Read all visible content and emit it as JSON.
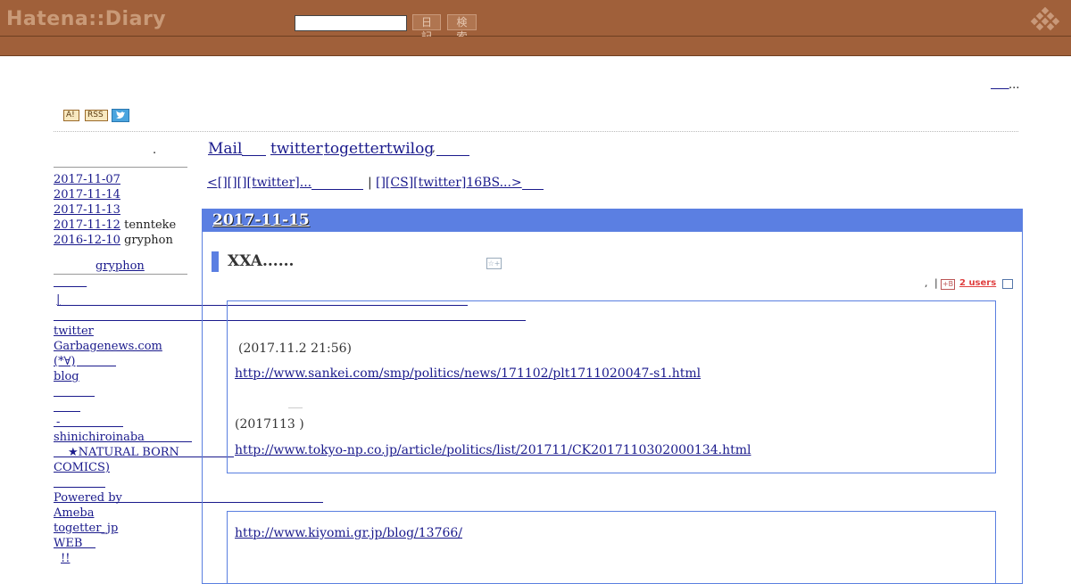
{
  "header": {
    "logo": "Hatena::Diary",
    "diary_button": "日記",
    "search_button": "検索"
  },
  "top_right": {
    "dots": "..."
  },
  "icons": {
    "antenna": "A!",
    "rss": "RSS",
    "twitter": "twitter-icon"
  },
  "sidebar": {
    "dot": ".",
    "recent": [
      {
        "date": "2017-11-07",
        "user": ""
      },
      {
        "date": "2017-11-14",
        "user": ""
      },
      {
        "date": "2017-11-13",
        "user": ""
      },
      {
        "date": "2017-11-12",
        "user": "tennteke"
      },
      {
        "date": "2016-12-10",
        "user": "gryphon"
      }
    ],
    "profile_title": "gryphon",
    "pipe": "|",
    "links": {
      "twitter": "twitter",
      "garbagenews": "Garbagenews.com",
      "face": "(*∀)",
      "blog": "blog",
      "dash": "-",
      "shinichi": "shinichiroinaba",
      "natural": "★NATURAL BORN",
      "comics": "COMICS)",
      "powered": "Powered by",
      "ameba": "Ameba",
      "togetter_jp": "togetter_jp",
      "web": "WEB",
      "excl": "!!"
    }
  },
  "nav": {
    "mail": "Mail",
    "twitter": "twitter",
    "togetter": "togettertwilog",
    "comma": ","
  },
  "pager": {
    "prev": "<[][][][twitter]...",
    "sep": "|",
    "next": "[][CS][twitter]16BS...>"
  },
  "day": {
    "date": "2017-11-15",
    "section_title": "XXA......",
    "star": "☆+",
    "meta_comma": ",",
    "meta_pipe": "|",
    "hatebu": "+B",
    "users": "2 users"
  },
  "quote1": {
    "time": "(2017.11.2 21:56)",
    "url1": "http://www.sankei.com/smp/politics/news/171102/plt1711020047-s1.html",
    "date2": "(2017113 )",
    "url2": "http://www.tokyo-np.co.jp/article/politics/list/201711/CK2017110302000134.html"
  },
  "quote2": {
    "url": "http://www.kiyomi.gr.jp/blog/13766/"
  }
}
